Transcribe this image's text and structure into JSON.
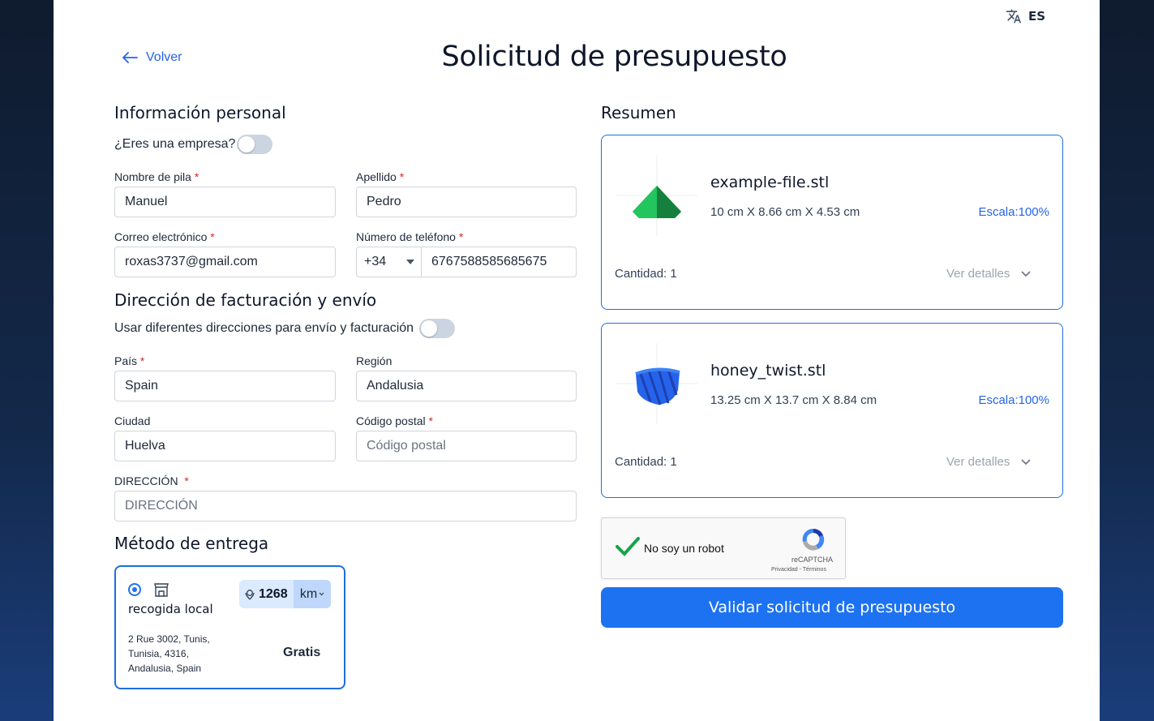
{
  "lang": {
    "code": "ES",
    "icon": "translate-icon"
  },
  "header": {
    "back_label": "Volver",
    "title": "Solicitud de presupuesto"
  },
  "personal": {
    "heading": "Información personal",
    "company_question": "¿Eres una empresa?",
    "company_toggle_on": false,
    "first_name": {
      "label": "Nombre de pila",
      "value": "Manuel"
    },
    "last_name": {
      "label": "Apellido",
      "value": "Pedro"
    },
    "email": {
      "label": "Correo electrónico",
      "value": "roxas3737@gmail.com"
    },
    "phone": {
      "label": "Número de teléfono",
      "prefix": "+34",
      "value": "6767588585685675"
    }
  },
  "address": {
    "heading": "Dirección de facturación y envío",
    "different_label": "Usar diferentes direcciones para envío y facturación",
    "different_toggle_on": false,
    "country": {
      "label": "País",
      "value": "Spain"
    },
    "region": {
      "label": "Región",
      "value": "Andalusia"
    },
    "city": {
      "label": "Ciudad",
      "value": "Huelva"
    },
    "postal": {
      "label": "Código postal",
      "placeholder": "Código postal"
    },
    "street": {
      "label": "DIRECCIÓN",
      "placeholder": "DIRECCIÓN"
    }
  },
  "delivery": {
    "heading": "Método de entrega",
    "option_name": "recogida local",
    "distance": "1268",
    "unit": "km",
    "address_lines": [
      "2 Rue 3002, Tunis,",
      "Tunisia, 4316,",
      "Andalusia, Spain"
    ],
    "price": "Gratis"
  },
  "summary": {
    "heading": "Resumen",
    "items": [
      {
        "name": "example-file.stl",
        "dims": "10 cm X 8.66 cm X 4.53 cm",
        "scale": "Escala:100%",
        "qty": "Cantidad: 1",
        "details": "Ver detalles",
        "color": "#16a34a"
      },
      {
        "name": "honey_twist.stl",
        "dims": "13.25 cm X 13.7 cm X 8.84 cm",
        "scale": "Escala:100%",
        "qty": "Cantidad: 1",
        "details": "Ver detalles",
        "color": "#2563eb"
      }
    ]
  },
  "captcha": {
    "label": "No soy un robot",
    "brand": "reCAPTCHA",
    "links": "Privacidad - Términos"
  },
  "submit_label": "Validar solicitud de presupuesto"
}
